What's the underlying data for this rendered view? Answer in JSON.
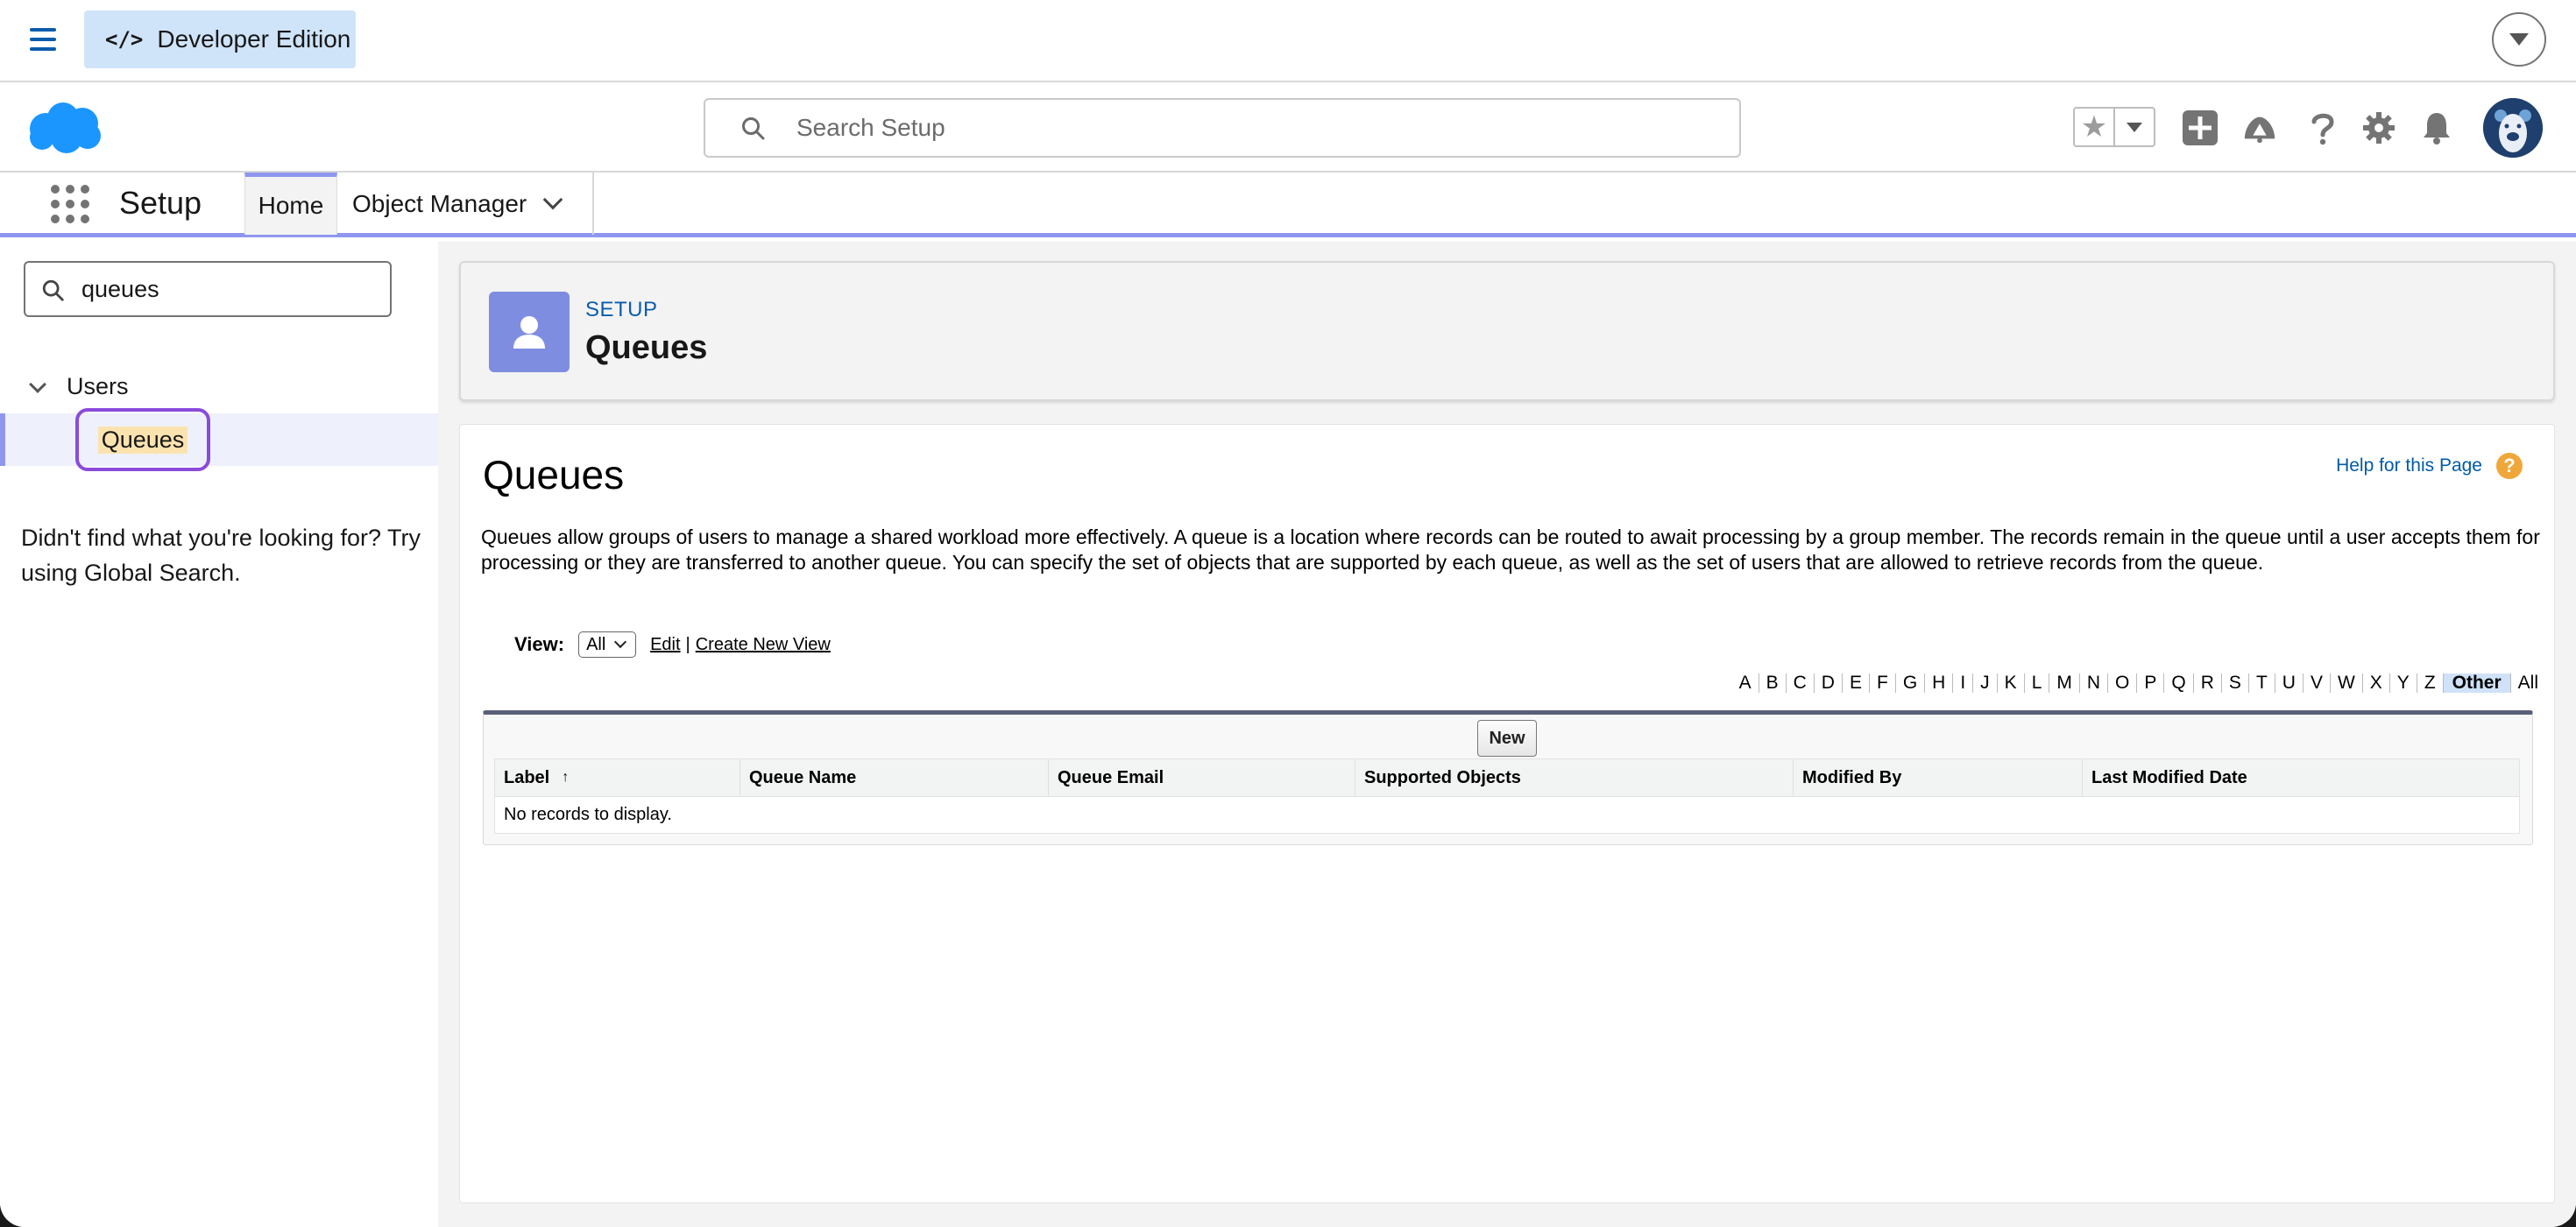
{
  "topbar": {
    "edition_label": "Developer Edition",
    "edition_icon": "code-icon"
  },
  "header": {
    "search_placeholder": "Search Setup",
    "icons": [
      "favorites-star-icon",
      "favorites-dropdown-icon",
      "add-icon",
      "trailhead-icon",
      "help-icon",
      "settings-gear-icon",
      "notifications-bell-icon",
      "user-avatar"
    ]
  },
  "nav": {
    "app_name": "Setup",
    "tabs": [
      {
        "label": "Home",
        "active": true
      },
      {
        "label": "Object Manager",
        "active": false
      }
    ]
  },
  "sidebar": {
    "quick_find_value": "queues",
    "group_label": "Users",
    "item_label": "Queues",
    "help_text": "Didn't find what you're looking for? Try using Global Search."
  },
  "page_header": {
    "eyebrow": "SETUP",
    "title": "Queues"
  },
  "content": {
    "title": "Queues",
    "help_link": "Help for this Page",
    "description": "Queues allow groups of users to manage a shared workload more effectively. A queue is a location where records can be routed to await processing by a group member. The records remain in the queue until a user accepts them for processing or they are transferred to another queue. You can specify the set of objects that are supported by each queue, as well as the set of users that are allowed to retrieve records from the queue.",
    "view_label": "View:",
    "view_value": "All",
    "edit_link": "Edit",
    "separator": "|",
    "create_view_link": "Create New View",
    "alphabet": [
      "A",
      "B",
      "C",
      "D",
      "E",
      "F",
      "G",
      "H",
      "I",
      "J",
      "K",
      "L",
      "M",
      "N",
      "O",
      "P",
      "Q",
      "R",
      "S",
      "T",
      "U",
      "V",
      "W",
      "X",
      "Y",
      "Z",
      "Other",
      "All"
    ],
    "alphabet_selected": "Other",
    "new_button": "New",
    "columns": [
      "Label",
      "Queue Name",
      "Queue Email",
      "Supported Objects",
      "Modified By",
      "Last Modified Date"
    ],
    "sort_indicator": "↑",
    "empty_message": "No records to display."
  },
  "colors": {
    "accent": "#8f96ef",
    "link": "#0b5cab",
    "highlight_outline": "#8a4bdc",
    "brand_cloud": "#1b96ff"
  }
}
